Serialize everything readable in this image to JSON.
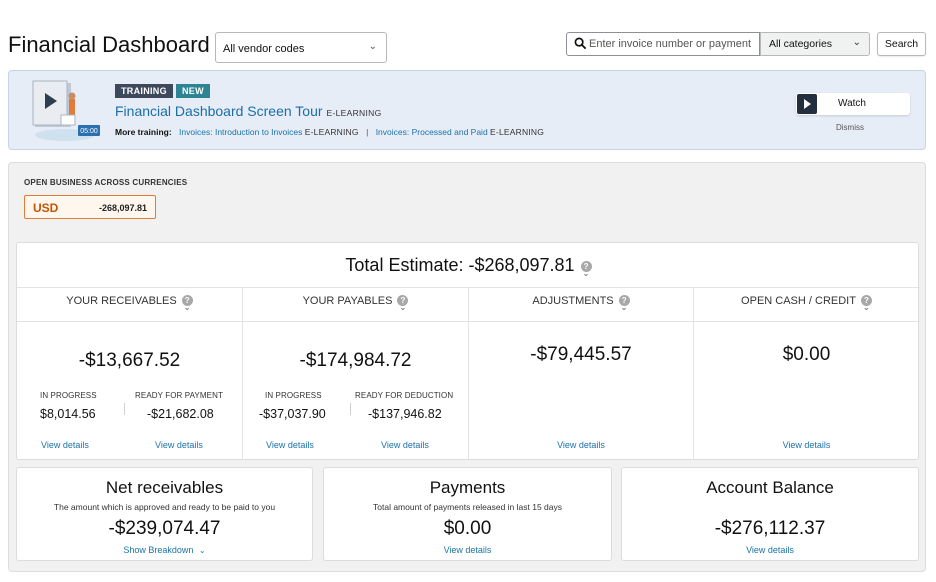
{
  "header": {
    "title": "Financial Dashboard",
    "vendor_select": "All vendor codes",
    "search_placeholder": "Enter invoice number or payment",
    "category_select": "All categories",
    "search_button": "Search"
  },
  "training": {
    "badge_training": "TRAINING",
    "badge_new": "NEW",
    "title": "Financial Dashboard Screen Tour",
    "title_type": "E-LEARNING",
    "video_duration": "05:00",
    "more_label": "More training:",
    "links": [
      {
        "label": "Invoices: Introduction to Invoices",
        "type": "E-LEARNING"
      },
      {
        "label": "Invoices: Processed and Paid",
        "type": "E-LEARNING"
      }
    ],
    "separator": "|",
    "watch_label": "Watch",
    "dismiss_label": "Dismiss"
  },
  "open_business": {
    "title": "OPEN BUSINESS ACROSS CURRENCIES",
    "currency": "USD",
    "amount": "-268,097.81"
  },
  "summary": {
    "total_label": "Total Estimate: -$268,097.81",
    "columns": [
      {
        "heading": "YOUR RECEIVABLES",
        "amount": "-$13,667.52",
        "sub": [
          {
            "label": "IN PROGRESS",
            "value": "$8,014.56",
            "link": "View details"
          },
          {
            "label": "READY FOR PAYMENT",
            "value": "-$21,682.08",
            "link": "View details"
          }
        ]
      },
      {
        "heading": "YOUR PAYABLES",
        "amount": "-$174,984.72",
        "sub": [
          {
            "label": "IN PROGRESS",
            "value": "-$37,037.90",
            "link": "View details"
          },
          {
            "label": "READY FOR DEDUCTION",
            "value": "-$137,946.82",
            "link": "View details"
          }
        ]
      },
      {
        "heading": "ADJUSTMENTS",
        "amount": "-$79,445.57",
        "link": "View details"
      },
      {
        "heading": "OPEN CASH / CREDIT",
        "amount": "$0.00",
        "link": "View details"
      }
    ]
  },
  "cards": [
    {
      "title": "Net receivables",
      "desc": "The amount which is approved and ready to be paid to you",
      "amount": "-$239,074.47",
      "link": "Show Breakdown"
    },
    {
      "title": "Payments",
      "desc": "Total amount of payments released in last 15 days",
      "amount": "$0.00",
      "link": "View details"
    },
    {
      "title": "Account Balance",
      "desc": "",
      "amount": "-$276,112.37",
      "link": "View details"
    }
  ],
  "colors": {
    "link": "#1a73a8",
    "currency_accent": "#c45500",
    "banner_bg": "#e7edf7",
    "badge_new": "#2e8493"
  }
}
